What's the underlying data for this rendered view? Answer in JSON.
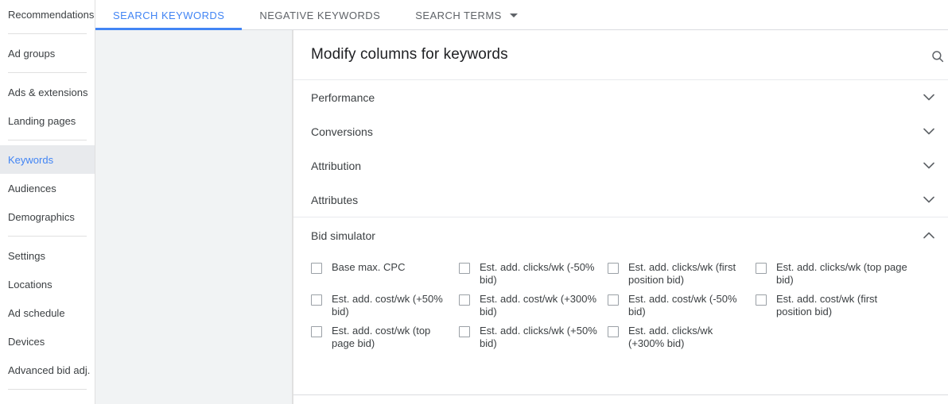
{
  "sidebar": {
    "items": [
      {
        "label": "Recommendations",
        "active": false,
        "divider_after": true
      },
      {
        "label": "Ad groups",
        "active": false,
        "divider_after": true
      },
      {
        "label": "Ads & extensions",
        "active": false,
        "divider_after": false
      },
      {
        "label": "Landing pages",
        "active": false,
        "divider_after": true
      },
      {
        "label": "Keywords",
        "active": true,
        "divider_after": false
      },
      {
        "label": "Audiences",
        "active": false,
        "divider_after": false
      },
      {
        "label": "Demographics",
        "active": false,
        "divider_after": true
      },
      {
        "label": "Settings",
        "active": false,
        "divider_after": false
      },
      {
        "label": "Locations",
        "active": false,
        "divider_after": false
      },
      {
        "label": "Ad schedule",
        "active": false,
        "divider_after": false
      },
      {
        "label": "Devices",
        "active": false,
        "divider_after": false
      },
      {
        "label": "Advanced bid adj.",
        "active": false,
        "divider_after": true
      }
    ]
  },
  "tabs": [
    {
      "label": "SEARCH KEYWORDS",
      "active": true,
      "has_caret": false
    },
    {
      "label": "NEGATIVE KEYWORDS",
      "active": false,
      "has_caret": false
    },
    {
      "label": "SEARCH TERMS",
      "active": false,
      "has_caret": true
    }
  ],
  "panel": {
    "title": "Modify columns for keywords",
    "search_icon": "search-icon",
    "sections": [
      {
        "label": "Performance",
        "expanded": false,
        "chevron": "chevron-down-icon"
      },
      {
        "label": "Conversions",
        "expanded": false,
        "chevron": "chevron-down-icon"
      },
      {
        "label": "Attribution",
        "expanded": false,
        "chevron": "chevron-down-icon"
      },
      {
        "label": "Attributes",
        "expanded": false,
        "chevron": "chevron-down-icon"
      }
    ],
    "expanded_section": {
      "label": "Bid simulator",
      "expanded": true,
      "chevron": "chevron-up-icon",
      "checkbox_rows": [
        [
          {
            "label": "Base max. CPC",
            "checked": false
          },
          {
            "label": "Est. add. clicks/wk (-50% bid)",
            "checked": false
          },
          {
            "label": "Est. add. clicks/wk (first position bid)",
            "checked": false
          },
          {
            "label": "Est. add. clicks/wk (top page bid)",
            "checked": false
          }
        ],
        [
          {
            "label": "Est. add. cost/wk (+50% bid)",
            "checked": false
          },
          {
            "label": "Est. add. cost/wk (+300% bid)",
            "checked": false
          },
          {
            "label": "Est. add. cost/wk (-50% bid)",
            "checked": false
          },
          {
            "label": "Est. add. cost/wk (first position bid)",
            "checked": false
          }
        ],
        [
          {
            "label": "Est. add. cost/wk (top page bid)",
            "checked": false
          },
          {
            "label": "Est. add. clicks/wk (+50% bid)",
            "checked": false
          },
          {
            "label": "Est. add. clicks/wk (+300% bid)",
            "checked": false
          }
        ]
      ]
    }
  },
  "colors": {
    "accent": "#4285f4",
    "text_primary": "#202124",
    "text_secondary": "#3c4043",
    "text_muted": "#5f6368",
    "backdrop": "#f1f3f4",
    "active_nav_bg": "#e8eaed",
    "border": "#e0e0e0"
  }
}
